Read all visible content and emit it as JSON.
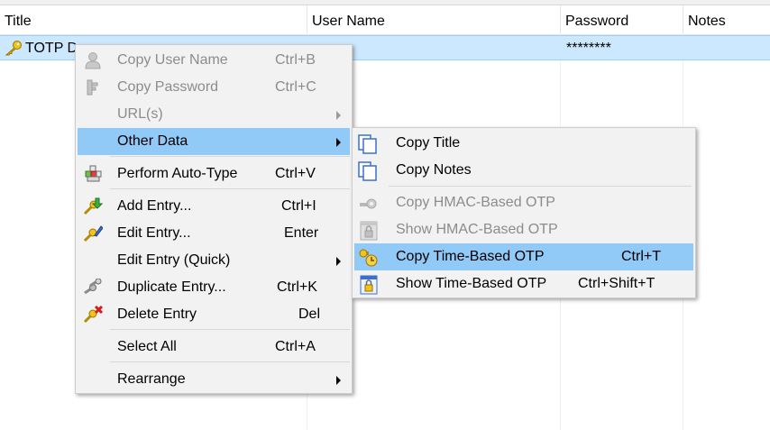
{
  "columns": [
    "Title",
    "User Name",
    "Password",
    "Notes"
  ],
  "entry": {
    "title": "TOTP D",
    "password": "********"
  },
  "context_menu": {
    "copy_user_name": {
      "label": "Copy User Name",
      "shortcut": "Ctrl+B"
    },
    "copy_password": {
      "label": "Copy Password",
      "shortcut": "Ctrl+C"
    },
    "urls": {
      "label": "URL(s)"
    },
    "other_data": {
      "label": "Other Data"
    },
    "perform_auto_type": {
      "label": "Perform Auto-Type",
      "shortcut": "Ctrl+V"
    },
    "add_entry": {
      "label": "Add Entry...",
      "shortcut": "Ctrl+I"
    },
    "edit_entry": {
      "label": "Edit Entry...",
      "shortcut": "Enter"
    },
    "edit_entry_quick": {
      "label": "Edit Entry (Quick)"
    },
    "duplicate_entry": {
      "label": "Duplicate Entry...",
      "shortcut": "Ctrl+K"
    },
    "delete_entry": {
      "label": "Delete Entry",
      "shortcut": "Del"
    },
    "select_all": {
      "label": "Select All",
      "shortcut": "Ctrl+A"
    },
    "rearrange": {
      "label": "Rearrange"
    }
  },
  "submenu": {
    "copy_title": {
      "label": "Copy Title"
    },
    "copy_notes": {
      "label": "Copy Notes"
    },
    "copy_hmac_otp": {
      "label": "Copy HMAC-Based OTP"
    },
    "show_hmac_otp": {
      "label": "Show HMAC-Based OTP"
    },
    "copy_time_otp": {
      "label": "Copy Time-Based OTP",
      "shortcut": "Ctrl+T"
    },
    "show_time_otp": {
      "label": "Show Time-Based OTP",
      "shortcut": "Ctrl+Shift+T"
    }
  }
}
